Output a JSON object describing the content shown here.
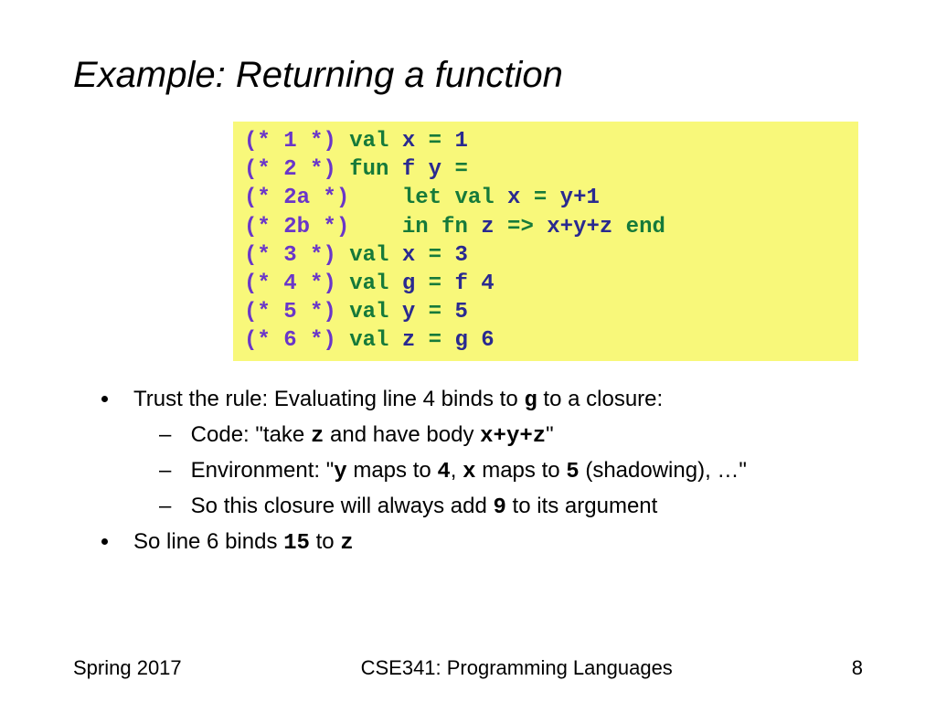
{
  "title": "Example: Returning a function",
  "code": {
    "l1": {
      "c": "(* 1 *)",
      "k": " val ",
      "i": "x",
      "k2": " = ",
      "v": "1"
    },
    "l2": {
      "c": "(* 2 *)",
      "k": " fun ",
      "i": "f y",
      "k2": " ="
    },
    "l2a": {
      "c": "(* 2a *)",
      "pad": "    ",
      "k": "let val ",
      "i": "x",
      "k2": " = ",
      "v": "y+1"
    },
    "l2b": {
      "c": "(* 2b *)",
      "pad": "    ",
      "k": "in fn ",
      "i": "z",
      "k2": " => ",
      "v": "x+y+z",
      "e": " end"
    },
    "l3": {
      "c": "(* 3 *)",
      "k": " val ",
      "i": "x",
      "k2": " = ",
      "v": "3"
    },
    "l4": {
      "c": "(* 4 *)",
      "k": " val ",
      "i": "g",
      "k2": " = ",
      "v": "f 4"
    },
    "l5": {
      "c": "(* 5 *)",
      "k": " val ",
      "i": "y",
      "k2": " = ",
      "v": "5"
    },
    "l6": {
      "c": "(* 6 *)",
      "k": " val ",
      "i": "z",
      "k2": " = ",
      "v": "g 6"
    }
  },
  "bullets": {
    "b1a": "Trust the rule: Evaluating line 4 binds to ",
    "b1m": "g",
    "b1b": " to a closure:",
    "s1a": "Code: \"take ",
    "s1m1": "z",
    "s1b": " and have body ",
    "s1m2": "x+y+z",
    "s1c": "\"",
    "s2a": "Environment: \"",
    "s2m1": "y",
    "s2b": " maps to ",
    "s2m2": "4",
    "s2c": ",  ",
    "s2m3": "x",
    "s2d": " maps to ",
    "s2m4": "5",
    "s2e": " (shadowing), …\"",
    "s3a": "So this closure will always add ",
    "s3m": "9",
    "s3b": " to its argument",
    "b2a": "So line 6 binds ",
    "b2m": "15",
    "b2b": " to ",
    "b2m2": "z"
  },
  "footer": {
    "left": "Spring 2017",
    "center": "CSE341: Programming Languages",
    "right": "8"
  }
}
